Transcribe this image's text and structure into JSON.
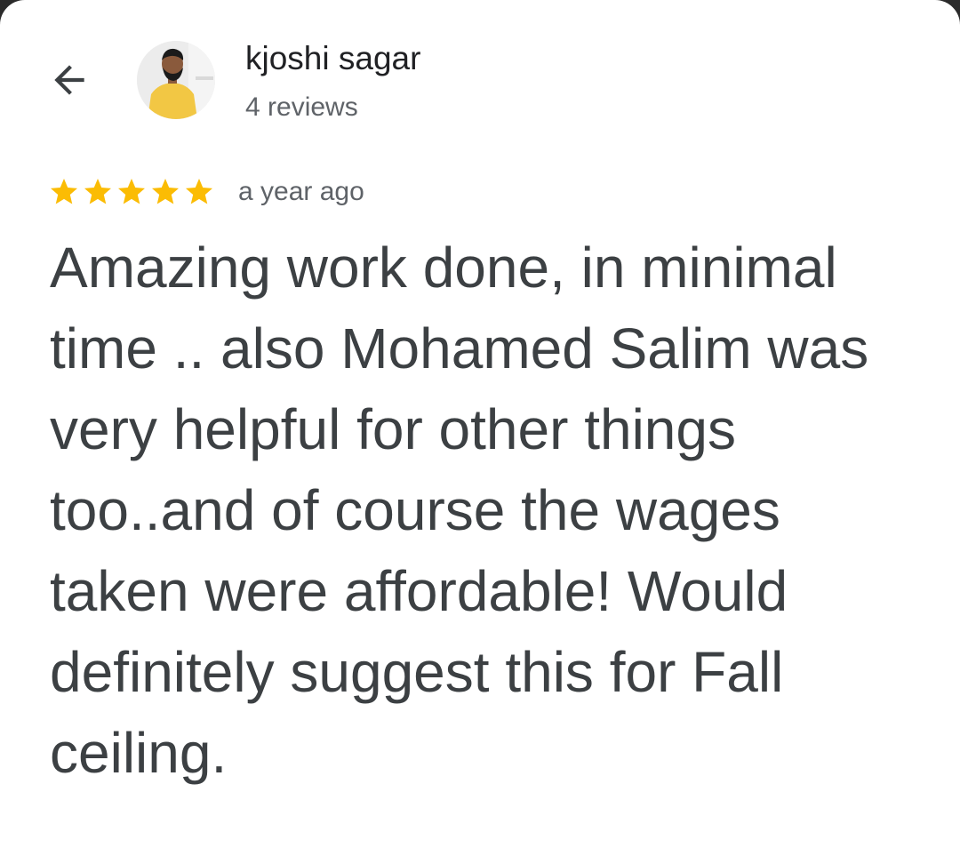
{
  "review": {
    "author": "kjoshi sagar",
    "review_count": "4 reviews",
    "rating": 5,
    "rating_max": 5,
    "time": "a year ago",
    "text": "Amazing work done, in minimal time .. also Mohamed Salim was very helpful for other things too..and of course the wages taken were affordable! Would definitely suggest this for Fall ceiling."
  },
  "icons": {
    "back": "arrow-back-icon",
    "star": "star-icon"
  },
  "colors": {
    "star": "#fbbc04",
    "name": "#202124",
    "secondary": "#5f6368",
    "body": "#3c4043"
  }
}
